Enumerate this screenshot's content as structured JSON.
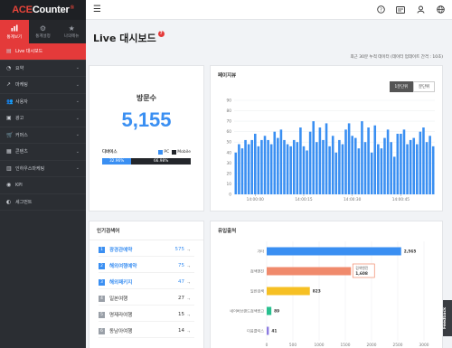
{
  "app": {
    "logo_ace": "ACE",
    "logo_counter": "Counter",
    "logo_mark": "®"
  },
  "top_nav": [
    {
      "label": "통계보기",
      "icon": "chart-icon",
      "active": true
    },
    {
      "label": "통계설정",
      "icon": "gear-icon",
      "active": false
    },
    {
      "label": "나의메뉴",
      "icon": "star-icon",
      "active": false
    }
  ],
  "menu": [
    {
      "label": "Live 대시보드",
      "icon": "dashboard-icon",
      "active": true,
      "chevron": false
    },
    {
      "label": "요약",
      "icon": "summary-icon",
      "active": false,
      "chevron": true
    },
    {
      "label": "마케팅",
      "icon": "marketing-icon",
      "active": false,
      "chevron": true
    },
    {
      "label": "사용자",
      "icon": "users-icon",
      "active": false,
      "chevron": true
    },
    {
      "label": "광고",
      "icon": "ads-icon",
      "active": false,
      "chevron": true
    },
    {
      "label": "커머스",
      "icon": "commerce-icon",
      "active": false,
      "chevron": true
    },
    {
      "label": "콘텐츠",
      "icon": "content-icon",
      "active": false,
      "chevron": true
    },
    {
      "label": "인하우스마케팅",
      "icon": "inhouse-icon",
      "active": false,
      "chevron": true
    },
    {
      "label": "KPI",
      "icon": "kpi-icon",
      "active": false,
      "chevron": false
    },
    {
      "label": "세그먼트",
      "icon": "segment-icon",
      "active": false,
      "chevron": false
    }
  ],
  "header_icons": [
    "help-icon",
    "notice-icon",
    "user-icon",
    "globe-icon"
  ],
  "page": {
    "title": "Live 대시보드",
    "help": "?",
    "updated": "최근 30분 누적 데이터 (데이터 업데이트 간격 : 10초)"
  },
  "visitors": {
    "label": "방문수",
    "value": "5,155",
    "device_label": "디바이스",
    "legend_pc": "PC",
    "legend_mobile": "Mobile",
    "pc_pct": "32.96%",
    "mobile_pct": "66.98%",
    "pc_fraction": 0.3296,
    "colors": {
      "pc": "#3a8ff2",
      "mobile": "#23262b"
    }
  },
  "pageview": {
    "title": "페이지뷰",
    "toggle": [
      {
        "label": "1분단위",
        "on": true
      },
      {
        "label": "분단위",
        "on": false
      }
    ],
    "chart_data": {
      "type": "bar",
      "ylim": [
        0,
        90
      ],
      "yticks": [
        0,
        10,
        20,
        30,
        40,
        50,
        60,
        70,
        80,
        90
      ],
      "xticks": [
        "14:00:00",
        "14:00:15",
        "14:00:30",
        "14:00:45"
      ],
      "tick_positions": [
        6,
        21,
        36,
        51
      ],
      "values": [
        40,
        48,
        44,
        52,
        48,
        52,
        58,
        46,
        52,
        56,
        52,
        48,
        60,
        54,
        62,
        52,
        48,
        46,
        52,
        50,
        64,
        46,
        42,
        60,
        70,
        50,
        64,
        52,
        68,
        46,
        56,
        40,
        52,
        48,
        62,
        68,
        56,
        54,
        44,
        70,
        50,
        64,
        40,
        66,
        48,
        44,
        54,
        62,
        50,
        36,
        58,
        58,
        62,
        48,
        52,
        54,
        48,
        60,
        64,
        50,
        56,
        46
      ],
      "color": "#3a8ff2"
    }
  },
  "popular": {
    "title": "인기검색어",
    "items": [
      {
        "rank": "1",
        "keyword": "광경관예약",
        "count": "575",
        "highlight": true
      },
      {
        "rank": "2",
        "keyword": "해외여행예약",
        "count": "75",
        "highlight": true
      },
      {
        "rank": "3",
        "keyword": "해외패키지",
        "count": "47",
        "highlight": true
      },
      {
        "rank": "4",
        "keyword": "일본여행",
        "count": "27",
        "highlight": false
      },
      {
        "rank": "5",
        "keyword": "명제라여행",
        "count": "15",
        "highlight": false
      },
      {
        "rank": "6",
        "keyword": "동남아여행",
        "count": "14",
        "highlight": false
      }
    ],
    "arrow": "→"
  },
  "inflow": {
    "title": "유입출처",
    "chart_data": {
      "type": "bar",
      "orientation": "horizontal",
      "categories": [
        "기타",
        "검색엔진",
        "일반검색",
        "네이버브랜드검색광고",
        "다음클릭스"
      ],
      "values": [
        2565,
        1608,
        823,
        89,
        41
      ],
      "value_labels": [
        "2,565",
        "",
        "823",
        "89",
        "41"
      ],
      "colors": [
        "#3a8ff2",
        "#f08a6c",
        "#f6c024",
        "#28c08f",
        "#8c7be0"
      ],
      "xlim": [
        0,
        3000
      ],
      "xticks": [
        0,
        500,
        1000,
        1500,
        2000,
        2500,
        3000
      ],
      "tooltip": {
        "label": "검색엔진",
        "value": "1,608"
      }
    }
  },
  "feedback": "Feedback"
}
